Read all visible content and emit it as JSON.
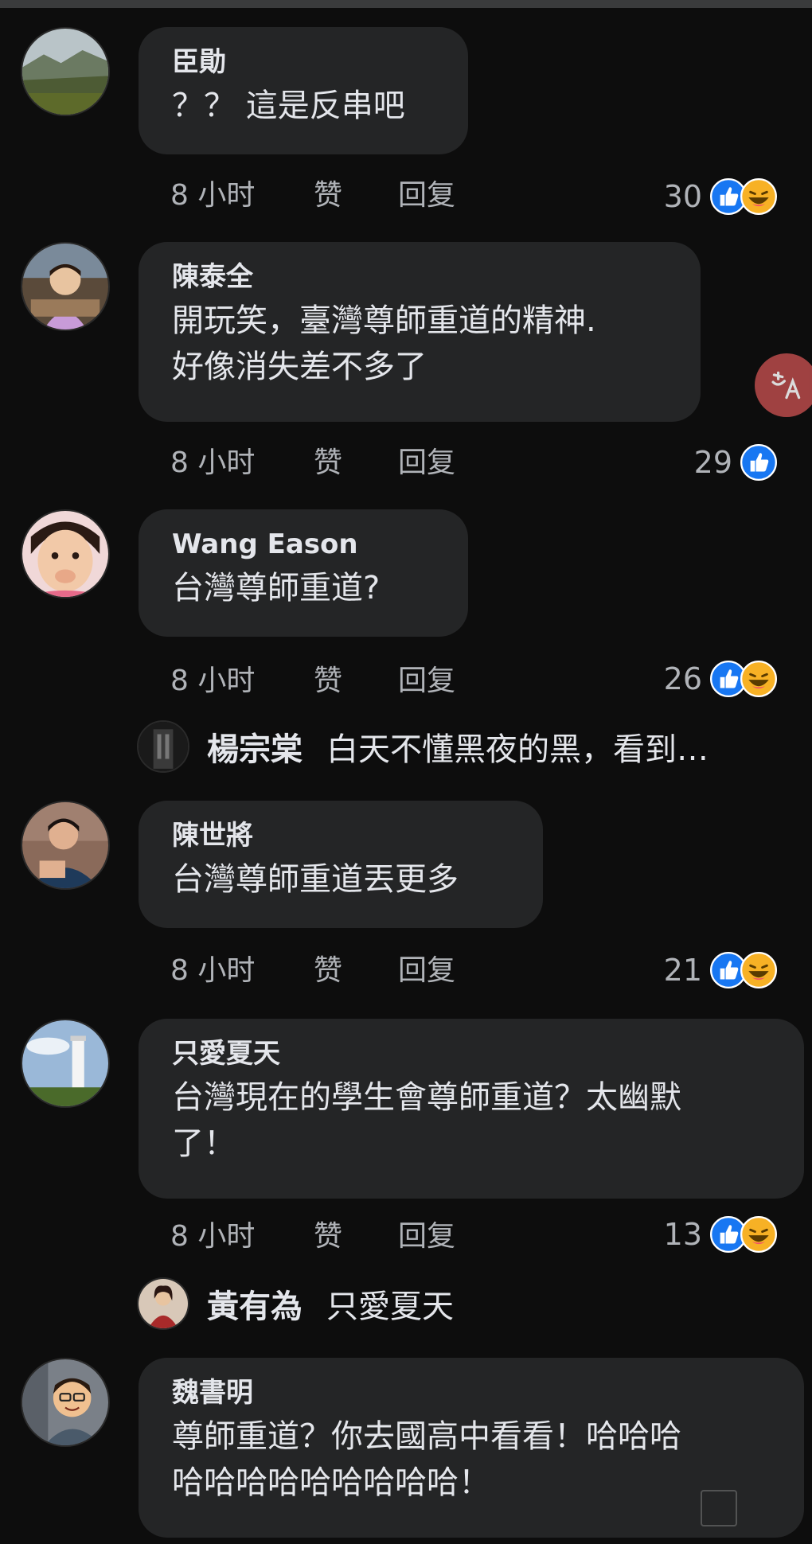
{
  "comments": [
    {
      "name": "臣勛",
      "text": "？？ 這是反串吧",
      "time": "8 小时",
      "like": "赞",
      "reply": "回复",
      "count": "30",
      "reactions": [
        "like",
        "haha"
      ]
    },
    {
      "name": "陳泰全",
      "text": "開玩笑，臺灣尊師重道的精神.\n好像消失差不多了",
      "time": "8 小时",
      "like": "赞",
      "reply": "回复",
      "count": "29",
      "reactions": [
        "like"
      ]
    },
    {
      "name": "Wang Eason",
      "text": "台灣尊師重道?",
      "time": "8 小时",
      "like": "赞",
      "reply": "回复",
      "count": "26",
      "reactions": [
        "like",
        "haha"
      ]
    },
    {
      "name": "陳世將",
      "text": "台灣尊師重道丟更多",
      "time": "8 小时",
      "like": "赞",
      "reply": "回复",
      "count": "21",
      "reactions": [
        "like",
        "haha"
      ]
    },
    {
      "name": "只愛夏天",
      "text": "台灣現在的學生會尊師重道？太幽默\n了！",
      "time": "8 小时",
      "like": "赞",
      "reply": "回复",
      "count": "13",
      "reactions": [
        "like",
        "haha"
      ]
    },
    {
      "name": "魏書明",
      "text": "尊師重道？你去國高中看看！哈哈哈\n哈哈哈哈哈哈哈哈哈！"
    }
  ],
  "replies": [
    {
      "name": "楊宗棠",
      "text": "白天不懂黑夜的黑，看到…"
    },
    {
      "name": "黃有為",
      "text": "只愛夏天"
    }
  ],
  "colors": {
    "background": "#0d0d0d",
    "bubble": "#242526",
    "text": "#e4e6eb",
    "meta": "#b0b3b8",
    "like_blue": "#1877f2",
    "haha_yellow": "#f7b125"
  },
  "icons": {
    "translate": "translate-icon",
    "like": "like-reaction-icon",
    "haha": "haha-reaction-icon"
  }
}
